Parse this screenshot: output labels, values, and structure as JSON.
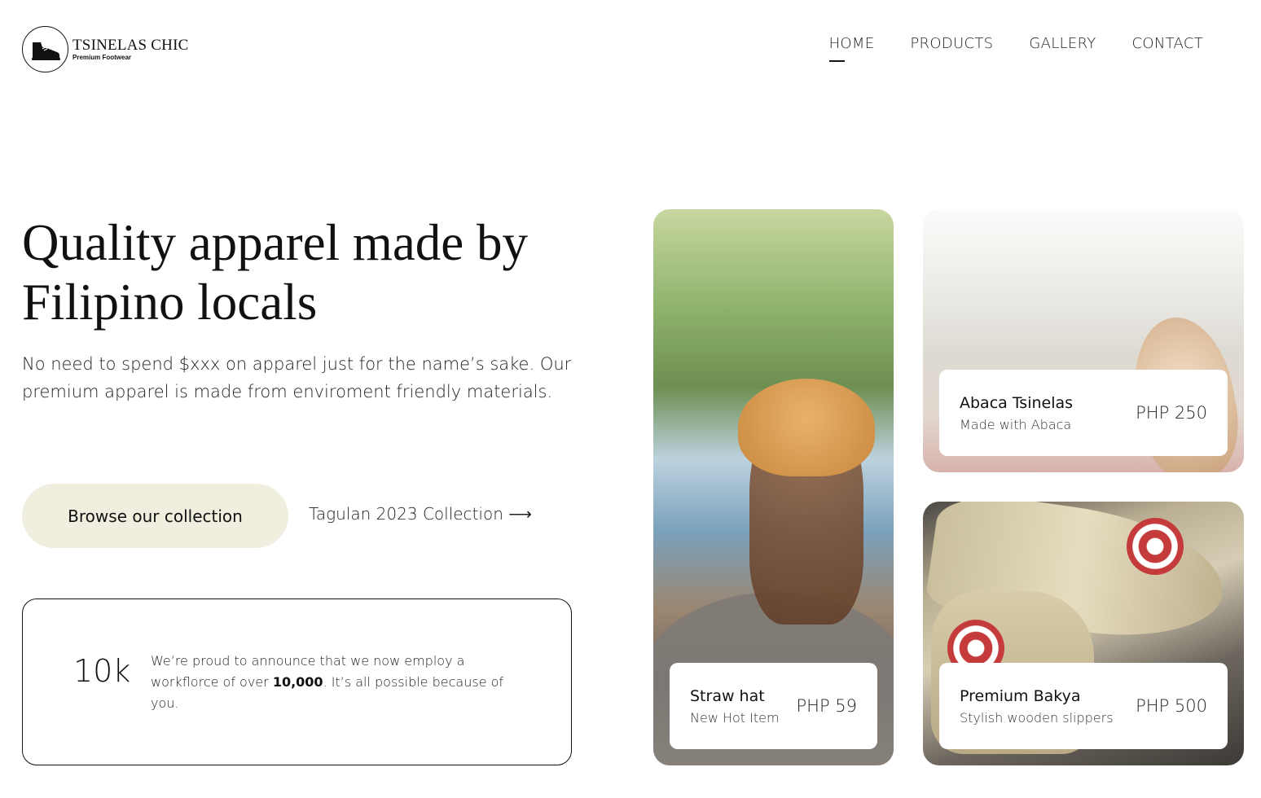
{
  "header": {
    "logo_name": "TSINELAS CHIC",
    "logo_tagline": "Premium Footwear",
    "logo_icon": "sneaker-icon",
    "nav": [
      {
        "label": "HOME",
        "active": true
      },
      {
        "label": "PRODUCTS",
        "active": false
      },
      {
        "label": "GALLERY",
        "active": false
      },
      {
        "label": "CONTACT",
        "active": false
      }
    ]
  },
  "hero": {
    "title": "Quality apparel made by Filipino locals",
    "subtitle": "No need to spend $xxx on apparel just for the name’s sake. Our premium apparel is made from enviroment friendly materials.",
    "primary_button": "Browse our collection",
    "secondary_link": "Tagulan 2023 Collection ⟶"
  },
  "stat": {
    "value": "10k",
    "text_before": "We’re proud to announce that we now employ a workflorce of over ",
    "text_bold": "10,000",
    "text_after": ". It’s all possible because of you."
  },
  "products": [
    {
      "name": "Straw hat",
      "description": "New Hot Item",
      "price": "PHP 59"
    },
    {
      "name": "Abaca Tsinelas",
      "description": "Made with Abaca",
      "price": "PHP 250"
    },
    {
      "name": "Premium Bakya",
      "description": "Stylish wooden slippers",
      "price": "PHP 500"
    }
  ],
  "colors": {
    "accent_button": "#efeedf",
    "text": "#111111",
    "background": "#ffffff"
  }
}
